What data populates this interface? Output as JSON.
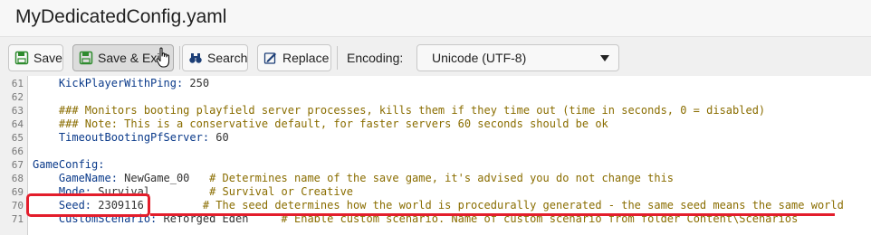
{
  "window": {
    "title": "MyDedicatedConfig.yaml"
  },
  "toolbar": {
    "save_label": "Save",
    "save_exit_label": "Save & Exit",
    "search_label": "Search",
    "replace_label": "Replace",
    "encoding_label": "Encoding:",
    "encoding_value": "Unicode (UTF-8)"
  },
  "editor": {
    "lines": [
      {
        "num": "61",
        "parts": [
          {
            "t": "    KickPlayerWithPing: ",
            "c": "k"
          },
          {
            "t": "250",
            "c": "v"
          }
        ]
      },
      {
        "num": "62",
        "parts": []
      },
      {
        "num": "63",
        "parts": [
          {
            "t": "    ### Monitors booting playfield server processes, kills them if they time out (time in seconds, 0 = disabled)",
            "c": "c"
          }
        ]
      },
      {
        "num": "64",
        "parts": [
          {
            "t": "    ### Note: This is a conservative default, for faster servers 60 seconds should be ok",
            "c": "c"
          }
        ]
      },
      {
        "num": "65",
        "parts": [
          {
            "t": "    TimeoutBootingPfServer: ",
            "c": "k"
          },
          {
            "t": "60",
            "c": "v"
          }
        ]
      },
      {
        "num": "66",
        "parts": []
      },
      {
        "num": "67",
        "parts": [
          {
            "t": "GameConfig:",
            "c": "k"
          }
        ]
      },
      {
        "num": "68",
        "parts": [
          {
            "t": "    GameName: ",
            "c": "k"
          },
          {
            "t": "NewGame_00   ",
            "c": "v"
          },
          {
            "t": "# Determines name of the save game, it's advised you do not change this",
            "c": "c"
          }
        ]
      },
      {
        "num": "69",
        "parts": [
          {
            "t": "    Mode: ",
            "c": "k"
          },
          {
            "t": "Survival         ",
            "c": "v"
          },
          {
            "t": "# Survival or Creative",
            "c": "c"
          }
        ]
      },
      {
        "num": "70",
        "parts": [
          {
            "t": "    Seed: ",
            "c": "k"
          },
          {
            "t": "2309116         ",
            "c": "v"
          },
          {
            "t": "# The seed determines how the world is procedurally generated - the same seed means the same world",
            "c": "c"
          }
        ]
      },
      {
        "num": "71",
        "parts": [
          {
            "t": "    CustomScenario: ",
            "c": "k"
          },
          {
            "t": "Reforged Eden     ",
            "c": "v"
          },
          {
            "t": "# Enable custom scenario. Name of custom scenario from folder Content\\Scenarios",
            "c": "c"
          }
        ]
      }
    ]
  }
}
